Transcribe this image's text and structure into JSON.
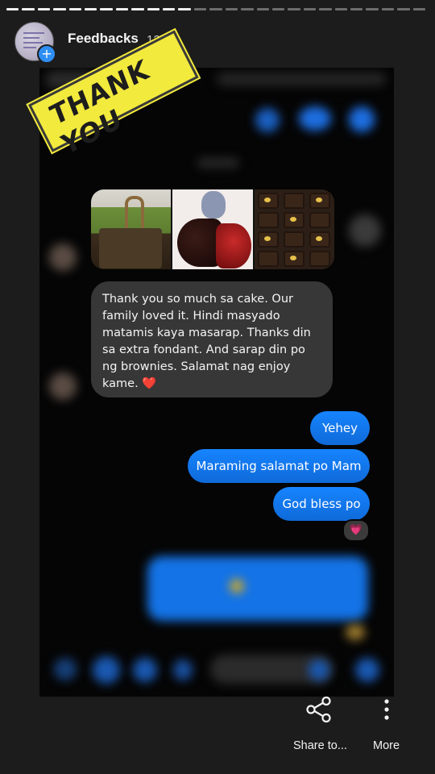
{
  "story": {
    "username": "Feedbacks",
    "time_ago": "12w",
    "segments_total": 27,
    "segments_viewed": 12,
    "colors": {
      "background": "#1c1c1c",
      "progress_viewed": "#efefef",
      "progress_pending": "#6d6d6d",
      "add_badge": "#2f8ef3"
    }
  },
  "sticker": {
    "text": "THANK YOU",
    "color": "#f2ea3d"
  },
  "chat": {
    "received_message": "Thank you so much sa cake. Our family loved it. Hindi masyado matamis kaya masarap. Thanks din sa extra fondant. And sarap din po ng brownies. Salamat nag enjoy kame.",
    "received_emoji": "❤️",
    "sent_messages": [
      "Yehey",
      "Maraming salamat po Mam",
      "God bless po"
    ],
    "reaction_emoji": "💗",
    "bubble_color": "#1473e6",
    "received_bubble_color": "#373737"
  },
  "actions": {
    "share_label": "Share to...",
    "more_label": "More"
  }
}
